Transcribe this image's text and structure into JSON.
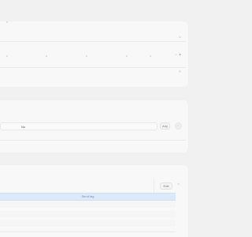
{
  "middle_panel": {
    "field_text": "No",
    "button_label": "Any"
  },
  "bottom_panel": {
    "button_label": "Edit",
    "highlight_row_text": "Send tag"
  },
  "colors": {
    "background": "#f1f1f1",
    "card": "#f8f8f8",
    "highlight": "#dde9f8",
    "highlight_text": "#6c8fc0"
  },
  "icons": {
    "expand": "chevron-down-icon",
    "collapse": "chevron-up-icon",
    "search": "search-icon",
    "sort": "sort-icon"
  }
}
